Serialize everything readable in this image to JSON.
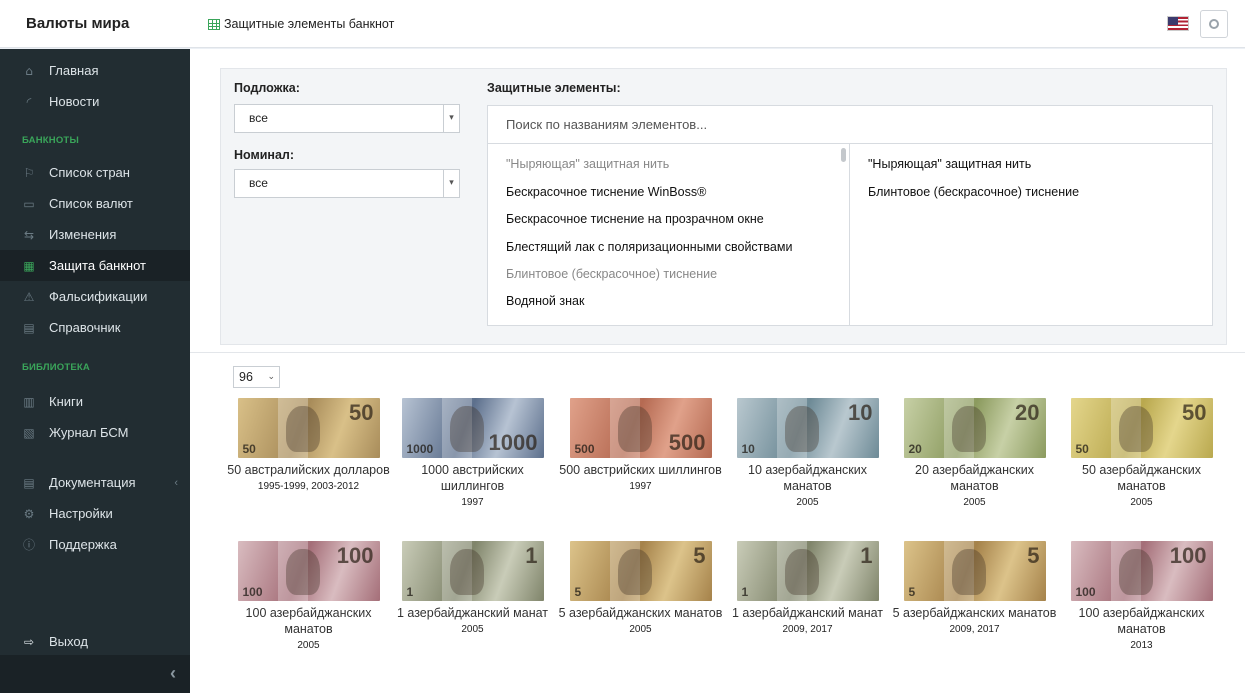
{
  "header": {
    "brand": "Валюты мира",
    "page_title": "Защитные элементы банкнот"
  },
  "sidebar": {
    "items": [
      {
        "icon": "home-icon",
        "glyph": "⌂",
        "label": "Главная"
      },
      {
        "icon": "rss-icon",
        "glyph": "◜",
        "label": "Новости"
      },
      {
        "icon": "flag-icon",
        "glyph": "⚐",
        "label": "Список стран"
      },
      {
        "icon": "money-icon",
        "glyph": "▭",
        "label": "Список валют"
      },
      {
        "icon": "exchange-icon",
        "glyph": "⇆",
        "label": "Изменения"
      },
      {
        "icon": "table-icon",
        "glyph": "▦",
        "label": "Защита банкнот"
      },
      {
        "icon": "warning-icon",
        "glyph": "⚠",
        "label": "Фальсификации"
      },
      {
        "icon": "file-icon",
        "glyph": "▤",
        "label": "Справочник"
      },
      {
        "icon": "book-icon",
        "glyph": "▥",
        "label": "Книги"
      },
      {
        "icon": "journal-icon",
        "glyph": "▧",
        "label": "Журнал БСМ"
      },
      {
        "icon": "document-icon",
        "glyph": "▤",
        "label": "Документация"
      },
      {
        "icon": "gear-icon",
        "glyph": "⚙",
        "label": "Настройки"
      },
      {
        "icon": "info-icon",
        "glyph": "ⓘ",
        "label": "Поддержка"
      },
      {
        "icon": "logout-icon",
        "glyph": "⇨",
        "label": "Выход"
      }
    ],
    "section_banknotes": "БАНКНОТЫ",
    "section_library": "БИБЛИОТЕКА"
  },
  "filters": {
    "substrate_label": "Подложка:",
    "substrate_value": "все",
    "denomination_label": "Номинал:",
    "denomination_value": "все",
    "elements_label": "Защитные элементы:",
    "search_placeholder": "Поиск по названиям элементов...",
    "available": [
      {
        "label": "\"Ныряющая\" защитная нить",
        "selected": true
      },
      {
        "label": "Бескрасочное тиснение WinBoss®",
        "selected": false
      },
      {
        "label": "Бескрасочное тиснение на прозрачном окне",
        "selected": false
      },
      {
        "label": "Блестящий лак с поляризационными свойствами",
        "selected": false
      },
      {
        "label": "Блинтовое (бескрасочное) тиснение",
        "selected": true
      },
      {
        "label": "Водяной знак",
        "selected": false
      }
    ],
    "chosen": [
      "\"Ныряющая\" защитная нить",
      "Блинтовое (бескрасочное) тиснение"
    ]
  },
  "results": {
    "per_page": "96",
    "banknotes": [
      {
        "name": "50 австралийских долларов",
        "years": "1995-1999, 2003-2012",
        "denom": "50",
        "colors": [
          "#d9c088",
          "#a88c5a"
        ]
      },
      {
        "name": "1000 австрийских шиллингов",
        "years": "1997",
        "denom": "1000",
        "colors": [
          "#b7c3d3",
          "#5c6f8c"
        ]
      },
      {
        "name": "500 австрийских шиллингов",
        "years": "1997",
        "denom": "500",
        "colors": [
          "#e0a18a",
          "#b56a52"
        ]
      },
      {
        "name": "10 азербайджанских манатов",
        "years": "2005",
        "denom": "10",
        "colors": [
          "#b9c8cf",
          "#6d8a96"
        ]
      },
      {
        "name": "20 азербайджанских манатов",
        "years": "2005",
        "denom": "20",
        "colors": [
          "#c7d0a6",
          "#8b9a5e"
        ]
      },
      {
        "name": "50 азербайджанских манатов",
        "years": "2005",
        "denom": "50",
        "colors": [
          "#e4d68c",
          "#b9a84e"
        ]
      },
      {
        "name": "100 азербайджанских манатов",
        "years": "2005",
        "denom": "100",
        "colors": [
          "#d9bcc0",
          "#a46e78"
        ]
      },
      {
        "name": "1 азербайджанский манат",
        "years": "2005",
        "denom": "1",
        "colors": [
          "#c9ccb8",
          "#7f846a"
        ]
      },
      {
        "name": "5 азербайджанских манатов",
        "years": "2005",
        "denom": "5",
        "colors": [
          "#dcc38a",
          "#a5824a"
        ]
      },
      {
        "name": "1 азербайджанский манат",
        "years": "2009, 2017",
        "denom": "1",
        "colors": [
          "#c9ccb8",
          "#7f846a"
        ]
      },
      {
        "name": "5 азербайджанских манатов",
        "years": "2009, 2017",
        "denom": "5",
        "colors": [
          "#dcc38a",
          "#a5824a"
        ]
      },
      {
        "name": "100 азербайджанских манатов",
        "years": "2013",
        "denom": "100",
        "colors": [
          "#d9bcc0",
          "#a46e78"
        ]
      }
    ]
  }
}
